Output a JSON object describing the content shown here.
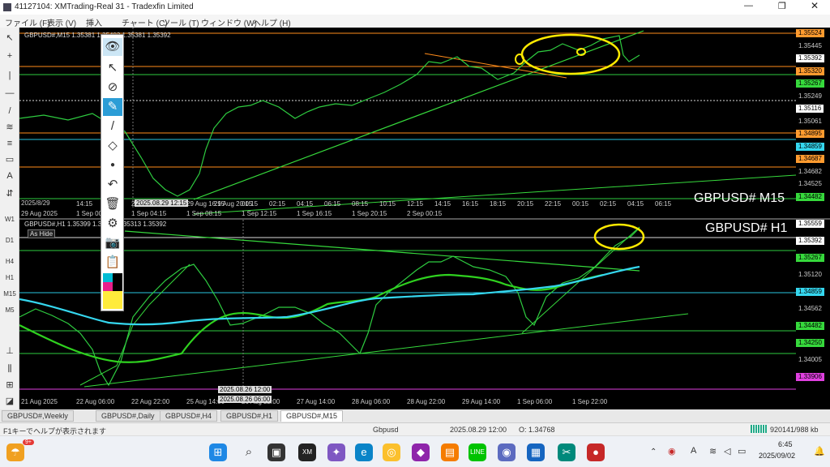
{
  "window": {
    "title": "41127104: XMTrading-Real 31 - Tradexfin Limited"
  },
  "menu": [
    "ファイル (F)",
    "表示 (V)",
    "挿入",
    "チャート (C)",
    "ツール (T)",
    "ウィンドウ (W)",
    "ヘルプ (H)"
  ],
  "chart_top": {
    "symbol_line": "GBPUSD#,M15  1.35381 1.35402 1.35381 1.35392",
    "big_label": "GBPUSD# M15",
    "price_labels": [
      {
        "text": "1.35524",
        "color": "#ff9b2f"
      },
      {
        "text": "1.35445",
        "color": null
      },
      {
        "text": "1.35392",
        "color": "#ffffff"
      },
      {
        "text": "1.35320",
        "color": "#ff9b2f"
      },
      {
        "text": "1.35267",
        "color": "#36d93c"
      },
      {
        "text": "1.35249",
        "color": null
      },
      {
        "text": "1.35116",
        "color": "#ffffff"
      },
      {
        "text": "1.35061",
        "color": null
      },
      {
        "text": "1.34895",
        "color": "#ff9b2f"
      },
      {
        "text": "1.34859",
        "color": "#35d7ef"
      },
      {
        "text": "1.34687",
        "color": "#ff9b2f"
      },
      {
        "text": "1.34682",
        "color": null
      },
      {
        "text": "1.34525",
        "color": null
      },
      {
        "text": "1.34482",
        "color": "#36d93c"
      }
    ],
    "time_labels": [
      "2025/8/29",
      "14:15",
      "16:15",
      "20:15",
      "22:15",
      "29 Aug 16:15",
      "29 Aug 20:15",
      "00:15",
      "02:15",
      "04:15",
      "06:15",
      "08:15",
      "10:15",
      "12:15",
      "14:15",
      "16:15",
      "18:15",
      "20:15",
      "22:15",
      "00:15",
      "02:15",
      "04:15",
      "06:15"
    ],
    "crosshair_time": "2025.08.29 12:15",
    "extra_time_labels": [
      "29 Aug 2025",
      "1 Sep 00:15",
      "1 Sep 04:15",
      "1 Sep 08:15",
      "1 Sep 12:15",
      "1 Sep 16:15",
      "1 Sep 20:15",
      "2 Sep 00:15"
    ]
  },
  "chart_bottom": {
    "symbol_line": "GBPUSD#,H1  1.35399 1.35399 1.35313 1.35392",
    "as_hide": "As Hide",
    "big_label": "GBPUSD# H1",
    "price_labels": [
      {
        "text": "1.35559",
        "color": "#ffffff"
      },
      {
        "text": "1.35392",
        "color": "#ffffff"
      },
      {
        "text": "1.35267",
        "color": "#36d93c"
      },
      {
        "text": "1.35120",
        "color": null
      },
      {
        "text": "1.34859",
        "color": "#35d7ef"
      },
      {
        "text": "1.34562",
        "color": null
      },
      {
        "text": "1.34482",
        "color": "#36d93c"
      },
      {
        "text": "1.34250",
        "color": "#36d93c"
      },
      {
        "text": "1.34005",
        "color": null
      },
      {
        "text": "1.33906",
        "color": "#e040e0"
      }
    ],
    "time_labels": [
      "21 Aug 2025",
      "22 Aug 06:00",
      "22 Aug 22:00",
      "25 Aug 14:00",
      "26 Aug 22:00",
      "27 Aug 14:00",
      "28 Aug 06:00",
      "28 Aug 22:00",
      "29 Aug 14:00",
      "1 Sep 06:00",
      "1 Sep 22:00"
    ],
    "crosshair_time_a": "2025.08.26 12:00",
    "crosshair_time_b": "2025.08.26 06:00"
  },
  "timeframes": [
    "W1",
    "D1",
    "H4",
    "H1",
    "M15",
    "M5"
  ],
  "tabs": [
    "GBPUSD#,Weekly",
    "GBPUSD#,Daily",
    "GBPUSD#,H4",
    "GBPUSD#,H1",
    "GBPUSD#,M15"
  ],
  "active_tab": 4,
  "status": {
    "help": "F1キーでヘルプが表示されます",
    "profile": "Gbpusd",
    "datetime": "2025.08.29 12:00",
    "open": "O: 1.34768",
    "traffic": "920141/988 kb"
  },
  "taskbar": {
    "time": "6:45",
    "date": "2025/09/02",
    "badge": "9+"
  }
}
